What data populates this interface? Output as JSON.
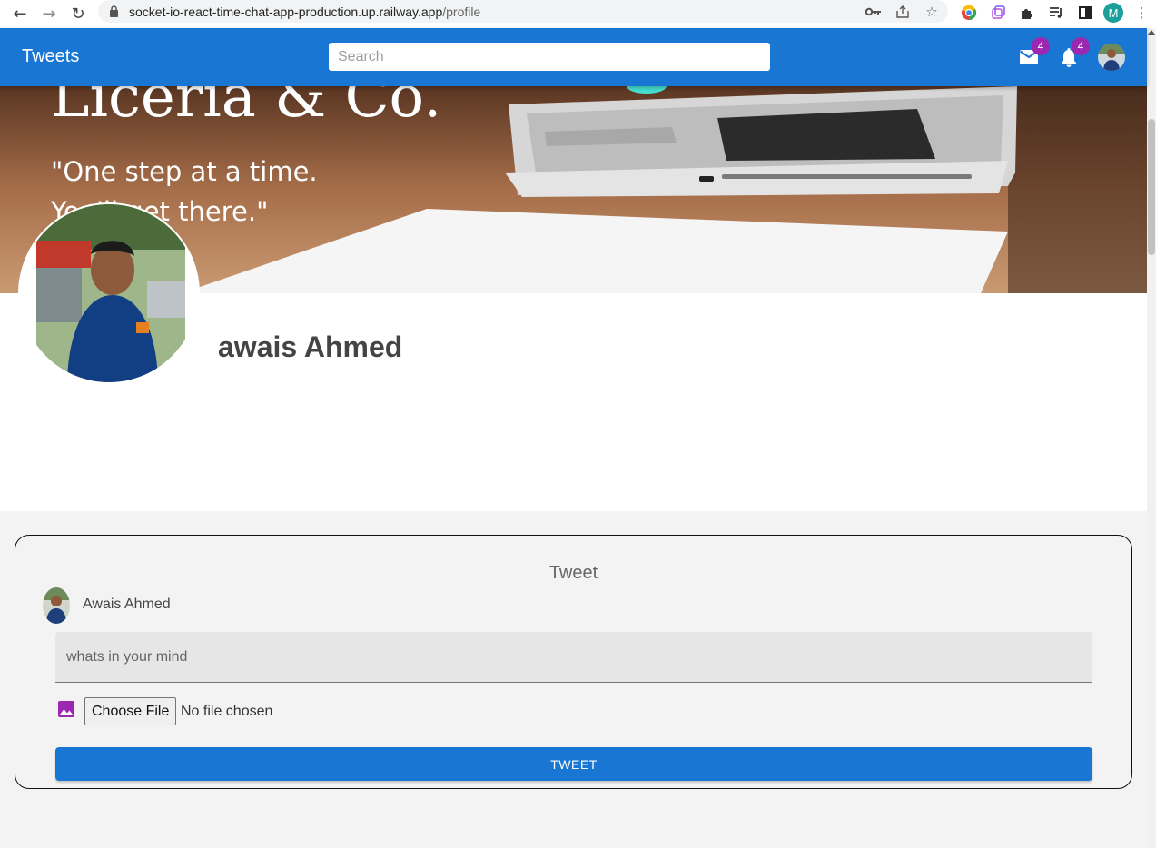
{
  "browser": {
    "url_host": "socket-io-react-time-chat-app-production.up.railway.app",
    "url_path": "/profile",
    "profile_initial": "M"
  },
  "appbar": {
    "title": "Tweets",
    "search_placeholder": "Search",
    "messages_badge": "4",
    "notifications_badge": "4",
    "color": "#1976d2"
  },
  "cover": {
    "title": "Liceria & Co.",
    "quote_line1": "\"One step at a time.",
    "quote_line2": "You'll get there.\""
  },
  "profile": {
    "name": "awais Ahmed"
  },
  "tweet_card": {
    "title": "Tweet",
    "author": "Awais Ahmed",
    "input_placeholder": "whats in your mind",
    "file_button": "Choose File",
    "file_status": "No file chosen",
    "submit_label": "TWEET",
    "accent": "#9c27b0"
  }
}
